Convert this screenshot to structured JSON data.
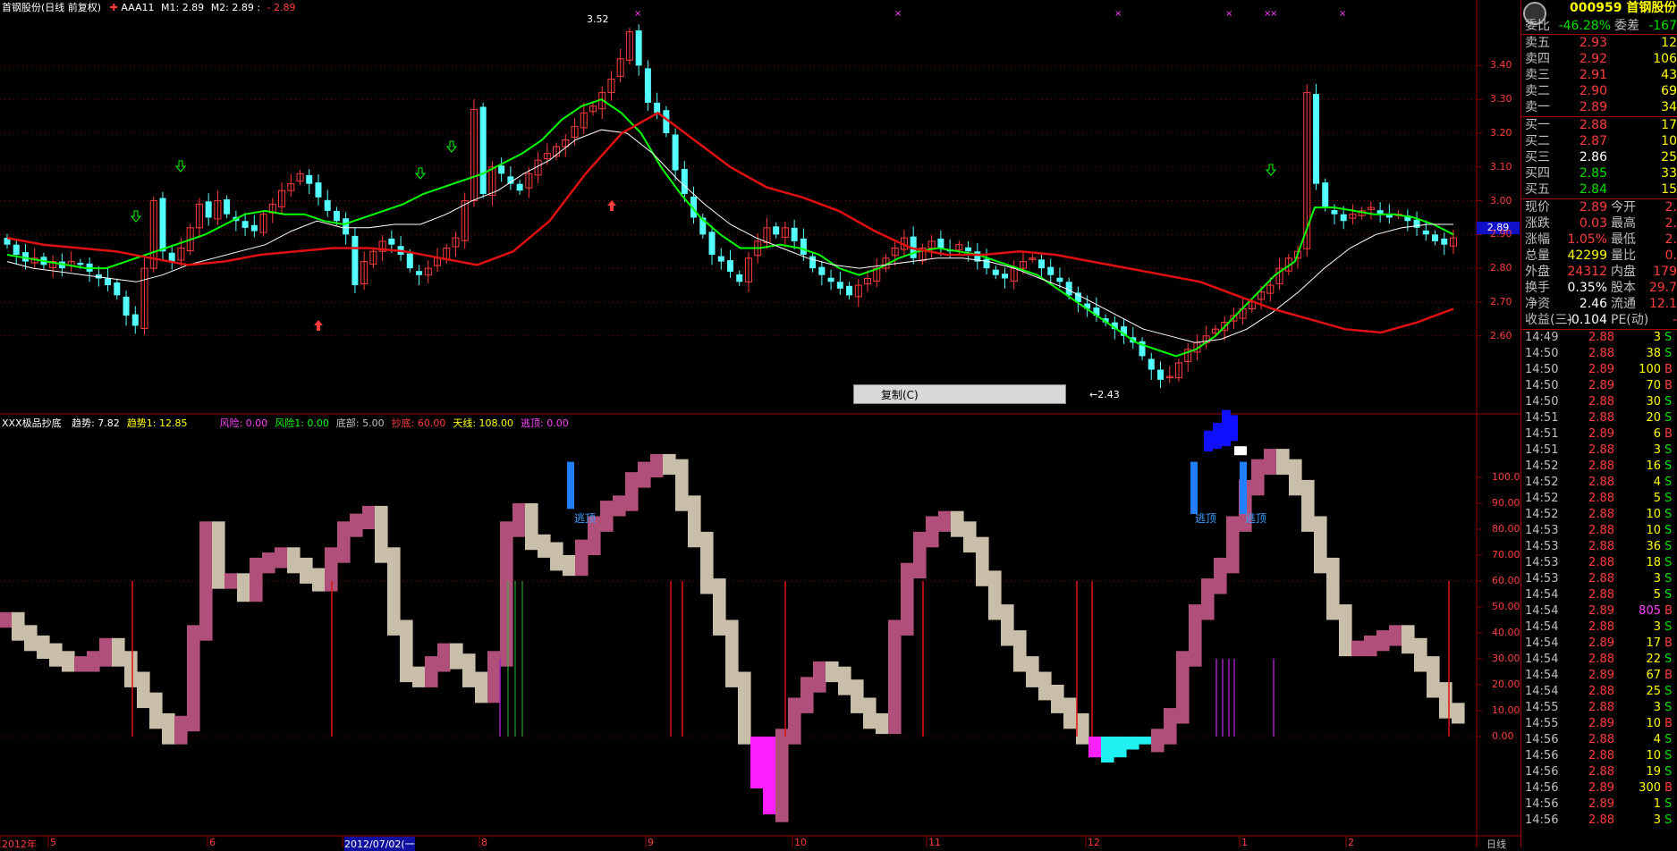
{
  "header": {
    "stock_title": "首钢股份(日线 前复权)",
    "indicator_name": "AAA11",
    "m1_label": "M1: 2.89",
    "m2_label": "M2: 2.89 :",
    "m3_label": "- 2.89"
  },
  "indicator_header": {
    "name": "XXX极品抄底",
    "items": [
      {
        "text": "趋势: 7.82",
        "color": "#ffffff"
      },
      {
        "text": "趋势1: 12.85",
        "color": "#ffff00"
      },
      {
        "text": "风险: 0.00",
        "color": "#ff40ff"
      },
      {
        "text": "风险1: 0.00",
        "color": "#00ff00"
      },
      {
        "text": "底部: 5.00",
        "color": "#c0c0c0"
      },
      {
        "text": "抄底: 60.00",
        "color": "#ff3c3c"
      },
      {
        "text": "天线: 108.00",
        "color": "#ffff00"
      },
      {
        "text": "逃顶: 0.00",
        "color": "#ff40ff"
      }
    ]
  },
  "annotations": {
    "high_label": "3.52",
    "low_label": "←2.43",
    "escape_labels": [
      "逃顶",
      "逃顶",
      "逃顶"
    ],
    "current_price_tag": "2.89"
  },
  "context_menu": {
    "copy_label": "复制(C)"
  },
  "bottom_axis": {
    "labels": [
      "2012年",
      "5",
      "6",
      "2012/07/02(一",
      "8",
      "9",
      "10",
      "11",
      "12",
      "1",
      "2"
    ],
    "period_label": "日线"
  },
  "colors": {
    "up": "#ff3c3c",
    "down": "#54ffff",
    "ma_short": "#00ff00",
    "ma_mid": "#ffffff",
    "ma_long": "#e01010",
    "osc_up": "#b0507a",
    "osc_down": "#c8beaa",
    "neg_magenta": "#ff20ff",
    "neg_cyan": "#20f0f0",
    "grid": "#8b0000"
  },
  "chart_data": [
    {
      "type": "candlestick",
      "title": "首钢股份(日线 前复权)",
      "ylim": [
        2.43,
        3.52
      ],
      "yticks": [
        2.6,
        2.7,
        2.8,
        2.9,
        3.0,
        3.1,
        3.2,
        3.3,
        3.4
      ],
      "ytick_labels": [
        "2.60",
        "2.70",
        "2.80",
        "2.90",
        "3.00",
        "3.10",
        "3.20",
        "3.30",
        "3.40"
      ],
      "last_close": 2.89,
      "x_period_labels": [
        "2012年",
        "5",
        "6",
        "2012/07/02(一",
        "8",
        "9",
        "10",
        "11",
        "12",
        "1",
        "2"
      ],
      "series": [
        {
          "name": "close",
          "values": [
            2.87,
            2.84,
            2.82,
            2.83,
            2.81,
            2.82,
            2.8,
            2.82,
            2.81,
            2.79,
            2.77,
            2.75,
            2.72,
            2.66,
            2.63,
            2.8,
            3.0,
            2.85,
            2.82,
            2.86,
            2.92,
            2.99,
            2.95,
            3.0,
            2.96,
            2.94,
            2.92,
            2.91,
            2.96,
            2.99,
            3.03,
            3.05,
            3.08,
            3.05,
            3.01,
            2.97,
            2.94,
            2.9,
            2.75,
            2.82,
            2.85,
            2.88,
            2.87,
            2.84,
            2.8,
            2.78,
            2.8,
            2.83,
            2.86,
            2.89,
            3.0,
            3.27,
            3.02,
            3.1,
            3.08,
            3.05,
            3.03,
            3.08,
            3.12,
            3.14,
            3.16,
            3.18,
            3.22,
            3.26,
            3.28,
            3.32,
            3.36,
            3.42,
            3.5,
            3.4,
            3.29,
            3.26,
            3.2,
            3.09,
            3.02,
            2.95,
            2.9,
            2.84,
            2.82,
            2.79,
            2.76,
            2.83,
            2.88,
            2.92,
            2.9,
            2.92,
            2.88,
            2.84,
            2.8,
            2.78,
            2.76,
            2.74,
            2.72,
            2.75,
            2.77,
            2.8,
            2.83,
            2.86,
            2.89,
            2.83,
            2.86,
            2.88,
            2.86,
            2.85,
            2.87,
            2.85,
            2.82,
            2.8,
            2.78,
            2.77,
            2.8,
            2.82,
            2.83,
            2.8,
            2.78,
            2.76,
            2.72,
            2.7,
            2.68,
            2.66,
            2.64,
            2.62,
            2.6,
            2.58,
            2.54,
            2.5,
            2.47,
            2.48,
            2.52,
            2.56,
            2.58,
            2.6,
            2.62,
            2.64,
            2.66,
            2.68,
            2.7,
            2.73,
            2.75,
            2.8,
            2.83,
            2.85,
            3.32,
            3.05,
            2.98,
            2.96,
            2.94,
            2.96,
            2.97,
            2.98,
            2.96,
            2.95,
            2.96,
            2.94,
            2.92,
            2.9,
            2.88,
            2.87,
            2.89
          ]
        },
        {
          "name": "ma_short",
          "values": [
            2.84,
            2.83,
            2.82,
            2.81,
            2.8,
            2.8,
            2.82,
            2.84,
            2.86,
            2.88,
            2.9,
            2.93,
            2.96,
            2.97,
            2.96,
            2.96,
            2.94,
            2.93,
            2.95,
            2.97,
            2.99,
            3.02,
            3.04,
            3.06,
            3.08,
            3.11,
            3.14,
            3.18,
            3.24,
            3.28,
            3.3,
            3.26,
            3.2,
            3.1,
            3.02,
            2.95,
            2.9,
            2.86,
            2.86,
            2.87,
            2.86,
            2.84,
            2.8,
            2.78,
            2.8,
            2.83,
            2.85,
            2.86,
            2.85,
            2.84,
            2.82,
            2.8,
            2.78,
            2.74,
            2.7,
            2.66,
            2.62,
            2.58,
            2.56,
            2.54,
            2.56,
            2.6,
            2.66,
            2.72,
            2.78,
            2.82,
            2.98,
            2.98,
            2.97,
            2.96,
            2.96,
            2.95,
            2.93,
            2.9
          ]
        },
        {
          "name": "ma_mid",
          "values": [
            2.82,
            2.8,
            2.79,
            2.78,
            2.77,
            2.76,
            2.78,
            2.81,
            2.83,
            2.85,
            2.87,
            2.91,
            2.94,
            2.92,
            2.92,
            2.93,
            2.93,
            2.96,
            3.0,
            3.03,
            3.08,
            3.12,
            3.18,
            3.21,
            3.2,
            3.14,
            3.06,
            2.99,
            2.93,
            2.89,
            2.86,
            2.83,
            2.81,
            2.8,
            2.81,
            2.82,
            2.83,
            2.83,
            2.82,
            2.8,
            2.77,
            2.74,
            2.7,
            2.66,
            2.62,
            2.6,
            2.58,
            2.59,
            2.62,
            2.67,
            2.73,
            2.8,
            2.86,
            2.9,
            2.92,
            2.93,
            2.93
          ]
        },
        {
          "name": "ma_long",
          "values": [
            2.89,
            2.87,
            2.86,
            2.85,
            2.83,
            2.81,
            2.82,
            2.84,
            2.85,
            2.86,
            2.86,
            2.85,
            2.83,
            2.81,
            2.85,
            2.94,
            3.08,
            3.2,
            3.26,
            3.18,
            3.1,
            3.04,
            3.01,
            2.97,
            2.91,
            2.86,
            2.84,
            2.84,
            2.85,
            2.84,
            2.82,
            2.8,
            2.78,
            2.76,
            2.72,
            2.68,
            2.65,
            2.62,
            2.61,
            2.64,
            2.68
          ]
        }
      ]
    },
    {
      "type": "area",
      "title": "XXX极品抄底",
      "ylim": [
        -35,
        110
      ],
      "yticks": [
        0,
        10,
        20,
        30,
        40,
        50,
        60,
        70,
        80,
        90,
        100
      ],
      "ytick_labels": [
        "0.00",
        "10.00",
        "20.00",
        "30.00",
        "40.00",
        "50.00",
        "60.00",
        "70.00",
        "80.00",
        "90.00",
        "100.0"
      ],
      "series": [
        {
          "name": "趋势",
          "values": [
            45,
            40,
            36,
            33,
            30,
            28,
            28,
            30,
            35,
            30,
            22,
            14,
            6,
            0,
            5,
            40,
            80,
            60,
            60,
            55,
            66,
            68,
            70,
            66,
            62,
            59,
            70,
            80,
            83,
            86,
            70,
            42,
            24,
            22,
            28,
            33,
            29,
            22,
            16,
            30,
            80,
            87,
            75,
            72,
            67,
            65,
            73,
            82,
            88,
            90,
            99,
            103,
            106,
            104,
            90,
            76,
            58,
            42,
            22,
            0,
            -20,
            -30,
            0,
            12,
            20,
            26,
            24,
            19,
            12,
            6,
            4,
            42,
            64,
            76,
            82,
            84,
            80,
            74,
            61,
            48,
            38,
            28,
            22,
            17,
            12,
            6,
            0,
            -8,
            -10,
            -8,
            -5,
            -3,
            0,
            8,
            30,
            48,
            58,
            66,
            82,
            96,
            104,
            108,
            104,
            96,
            82,
            66,
            48,
            34,
            34,
            36,
            38,
            40,
            35,
            28,
            18,
            10,
            8
          ]
        }
      ]
    }
  ],
  "panel": {
    "code_title": "000959 首钢股份",
    "ratio_row": {
      "l1": "委比",
      "v1": "-46.28%",
      "l2": "委差",
      "v2": "-167"
    },
    "sell": [
      {
        "label": "卖五",
        "price": "2.93",
        "vol": "12"
      },
      {
        "label": "卖四",
        "price": "2.92",
        "vol": "106"
      },
      {
        "label": "卖三",
        "price": "2.91",
        "vol": "43"
      },
      {
        "label": "卖二",
        "price": "2.90",
        "vol": "69"
      },
      {
        "label": "卖一",
        "price": "2.89",
        "vol": "34"
      }
    ],
    "buy": [
      {
        "label": "买一",
        "price": "2.88",
        "vol": "17"
      },
      {
        "label": "买二",
        "price": "2.87",
        "vol": "10"
      },
      {
        "label": "买三",
        "price": "2.86",
        "vol": "25"
      },
      {
        "label": "买四",
        "price": "2.85",
        "vol": "33"
      },
      {
        "label": "买五",
        "price": "2.84",
        "vol": "15"
      }
    ],
    "stats": [
      {
        "l1": "现价",
        "v1": "2.89",
        "c1": "red",
        "l2": "今开",
        "v2": "2."
      },
      {
        "l1": "涨跌",
        "v1": "0.03",
        "c1": "red",
        "l2": "最高",
        "v2": "2."
      },
      {
        "l1": "涨幅",
        "v1": "1.05%",
        "c1": "red",
        "l2": "最低",
        "v2": "2."
      },
      {
        "l1": "总量",
        "v1": "42299",
        "c1": "yellow",
        "l2": "量比",
        "v2": "0."
      },
      {
        "l1": "外盘",
        "v1": "24312",
        "c1": "red",
        "l2": "内盘",
        "v2": "179"
      },
      {
        "l1": "换手",
        "v1": "0.35%",
        "c1": "white",
        "l2": "股本",
        "v2": "29.7"
      },
      {
        "l1": "净资",
        "v1": "2.46",
        "c1": "white",
        "l2": "流通",
        "v2": "12.1"
      },
      {
        "l1": "收益(三)",
        "v1": "-0.104",
        "c1": "white",
        "l2": "PE(动)",
        "v2": "-"
      }
    ],
    "ticks": [
      {
        "t": "14:49",
        "p": "2.88",
        "v": "3",
        "d": "S"
      },
      {
        "t": "14:50",
        "p": "2.88",
        "v": "38",
        "d": "S"
      },
      {
        "t": "14:50",
        "p": "2.89",
        "v": "100",
        "d": "B"
      },
      {
        "t": "14:50",
        "p": "2.89",
        "v": "70",
        "d": "B"
      },
      {
        "t": "14:50",
        "p": "2.88",
        "v": "30",
        "d": "S"
      },
      {
        "t": "14:51",
        "p": "2.88",
        "v": "20",
        "d": "S"
      },
      {
        "t": "14:51",
        "p": "2.89",
        "v": "6",
        "d": "B"
      },
      {
        "t": "14:51",
        "p": "2.88",
        "v": "3",
        "d": "S"
      },
      {
        "t": "14:52",
        "p": "2.88",
        "v": "16",
        "d": "S"
      },
      {
        "t": "14:52",
        "p": "2.88",
        "v": "4",
        "d": "S"
      },
      {
        "t": "14:52",
        "p": "2.88",
        "v": "5",
        "d": "S"
      },
      {
        "t": "14:52",
        "p": "2.88",
        "v": "10",
        "d": "S"
      },
      {
        "t": "14:53",
        "p": "2.88",
        "v": "10",
        "d": "S"
      },
      {
        "t": "14:53",
        "p": "2.88",
        "v": "36",
        "d": "S"
      },
      {
        "t": "14:53",
        "p": "2.88",
        "v": "18",
        "d": "S"
      },
      {
        "t": "14:53",
        "p": "2.88",
        "v": "3",
        "d": "S"
      },
      {
        "t": "14:54",
        "p": "2.88",
        "v": "5",
        "d": "S"
      },
      {
        "t": "14:54",
        "p": "2.89",
        "v": "805",
        "d": "B"
      },
      {
        "t": "14:54",
        "p": "2.88",
        "v": "3",
        "d": "S"
      },
      {
        "t": "14:54",
        "p": "2.89",
        "v": "17",
        "d": "B"
      },
      {
        "t": "14:54",
        "p": "2.88",
        "v": "22",
        "d": "S"
      },
      {
        "t": "14:54",
        "p": "2.89",
        "v": "67",
        "d": "B"
      },
      {
        "t": "14:54",
        "p": "2.88",
        "v": "25",
        "d": "S"
      },
      {
        "t": "14:55",
        "p": "2.88",
        "v": "3",
        "d": "S"
      },
      {
        "t": "14:55",
        "p": "2.89",
        "v": "10",
        "d": "B"
      },
      {
        "t": "14:56",
        "p": "2.88",
        "v": "4",
        "d": "S"
      },
      {
        "t": "14:56",
        "p": "2.88",
        "v": "10",
        "d": "S"
      },
      {
        "t": "14:56",
        "p": "2.88",
        "v": "19",
        "d": "S"
      },
      {
        "t": "14:56",
        "p": "2.89",
        "v": "300",
        "d": "B"
      },
      {
        "t": "14:56",
        "p": "2.89",
        "v": "1",
        "d": "S"
      },
      {
        "t": "14:56",
        "p": "2.88",
        "v": "3",
        "d": "S"
      }
    ]
  }
}
